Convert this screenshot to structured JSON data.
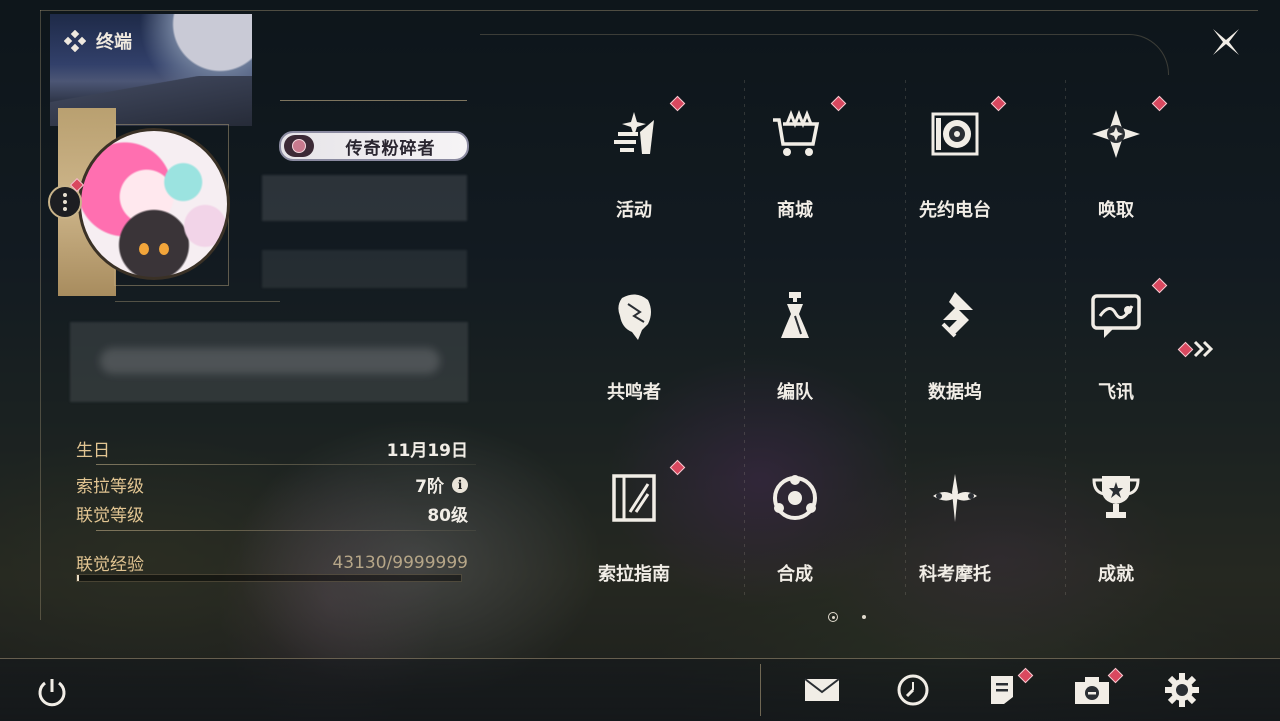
{
  "app": {
    "title": "终端"
  },
  "profile": {
    "title_badge": "传奇粉碎者",
    "birthday_label": "生日",
    "birthday_value": "11月19日",
    "sola_level_label": "索拉等级",
    "sola_level_value": "7阶",
    "union_level_label": "联觉等级",
    "union_level_value": "80级",
    "union_exp_label": "联觉经验",
    "union_exp_value": "43130/9999999",
    "union_exp_progress": 0.0043
  },
  "menu": {
    "items": [
      {
        "label": "活动",
        "icon": "events-icon",
        "badge": true
      },
      {
        "label": "商城",
        "icon": "shop-cart-icon",
        "badge": true
      },
      {
        "label": "先约电台",
        "icon": "radio-icon",
        "badge": true
      },
      {
        "label": "唤取",
        "icon": "convene-icon",
        "badge": true
      },
      {
        "label": "共鸣者",
        "icon": "resonator-icon",
        "badge": false
      },
      {
        "label": "编队",
        "icon": "team-icon",
        "badge": false
      },
      {
        "label": "数据坞",
        "icon": "databank-icon",
        "badge": false
      },
      {
        "label": "飞讯",
        "icon": "chat-icon",
        "badge": true
      },
      {
        "label": "索拉指南",
        "icon": "guidebook-icon",
        "badge": true
      },
      {
        "label": "合成",
        "icon": "synthesis-icon",
        "badge": false
      },
      {
        "label": "科考摩托",
        "icon": "motorcycle-icon",
        "badge": false
      },
      {
        "label": "成就",
        "icon": "trophy-icon",
        "badge": false
      }
    ],
    "page_index": 1,
    "page_count": 2
  },
  "bottom_bar": {
    "icons": [
      "power-icon",
      "mail-icon",
      "clock-icon",
      "notes-icon",
      "camera-icon",
      "settings-gear-icon"
    ]
  },
  "colors": {
    "accent_gold": "#e2c592",
    "badge_red": "#d9485f"
  }
}
